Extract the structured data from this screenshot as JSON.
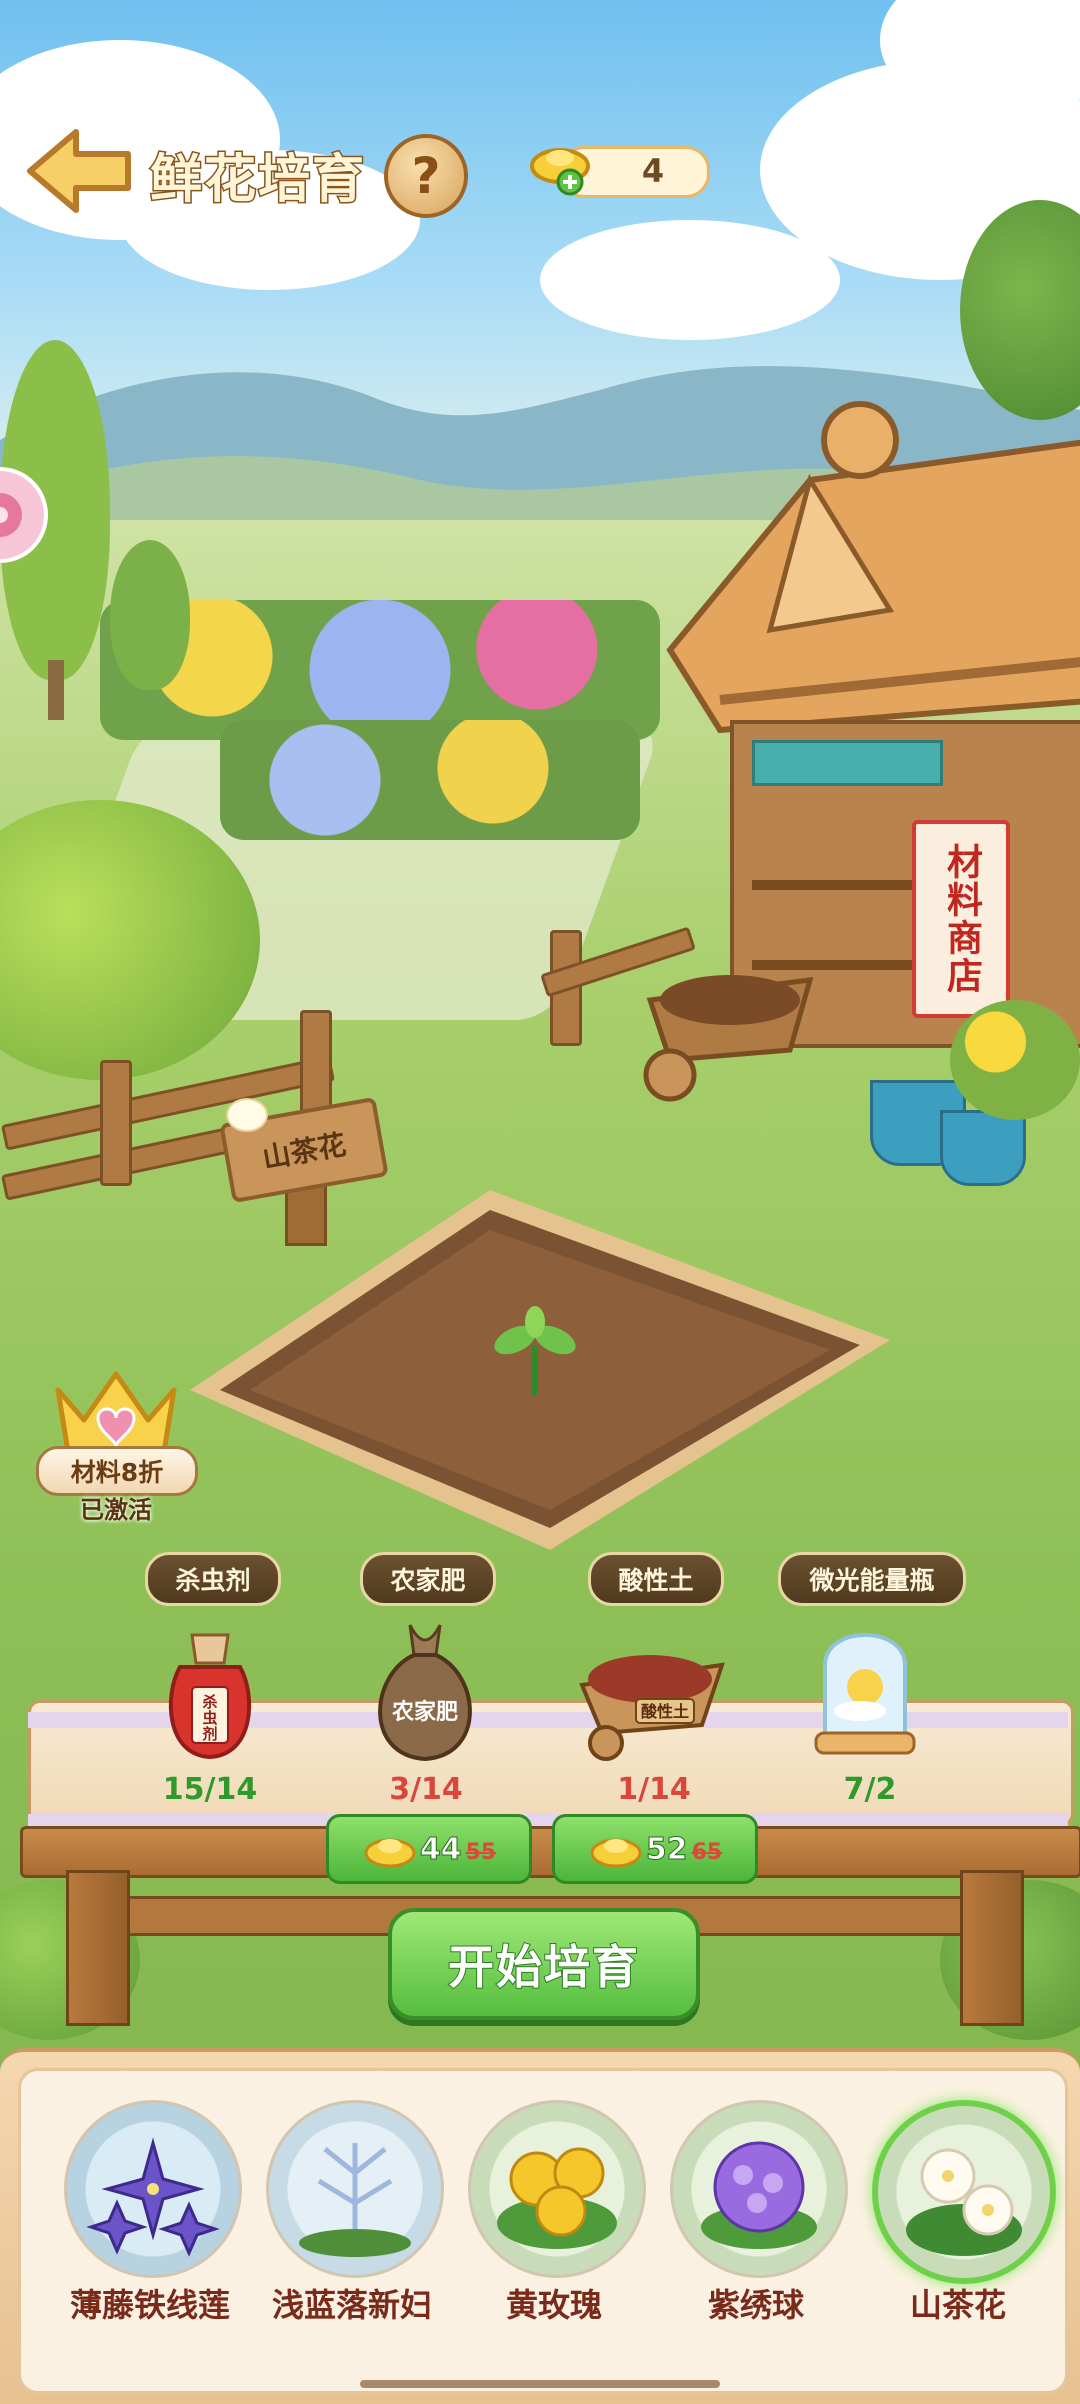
{
  "header": {
    "title": "鲜花培育",
    "help_label": "?",
    "currency_value": "4"
  },
  "scene": {
    "plot_sign": "山茶花",
    "shop_banner": "材料商店"
  },
  "vip": {
    "tag": "材料8折",
    "status": "已激活"
  },
  "materials": [
    {
      "name": "杀虫剂",
      "count": "15/14",
      "count_color": "#2f9a2a",
      "icon": "pesticide-jar-icon",
      "icon_text": "杀虫剂"
    },
    {
      "name": "农家肥",
      "count": "3/14",
      "count_color": "#d9463a",
      "icon": "fertilizer-sack-icon",
      "icon_text": "农家肥"
    },
    {
      "name": "酸性土",
      "count": "1/14",
      "count_color": "#d9463a",
      "icon": "acid-soil-wheelbarrow-icon",
      "icon_text": "酸性土"
    },
    {
      "name": "微光能量瓶",
      "count": "7/2",
      "count_color": "#2f9a2a",
      "icon": "light-energy-bottle-icon"
    }
  ],
  "buy_buttons": [
    {
      "price": "44",
      "old_price": "55"
    },
    {
      "price": "52",
      "old_price": "65"
    }
  ],
  "start_button": "开始培育",
  "flowers": [
    {
      "name": "薄藤铁线莲",
      "icon": "clematis-icon",
      "selected": false
    },
    {
      "name": "浅蓝落新妇",
      "icon": "astilbe-icon",
      "selected": false
    },
    {
      "name": "黄玫瑰",
      "icon": "yellow-rose-icon",
      "selected": false
    },
    {
      "name": "紫绣球",
      "icon": "purple-hydrangea-icon",
      "selected": false
    },
    {
      "name": "山茶花",
      "icon": "camellia-icon",
      "selected": true
    }
  ],
  "colors": {
    "accent_green": "#55be3f",
    "title_outline": "#8a5418",
    "price_strike": "#d94a3a"
  }
}
